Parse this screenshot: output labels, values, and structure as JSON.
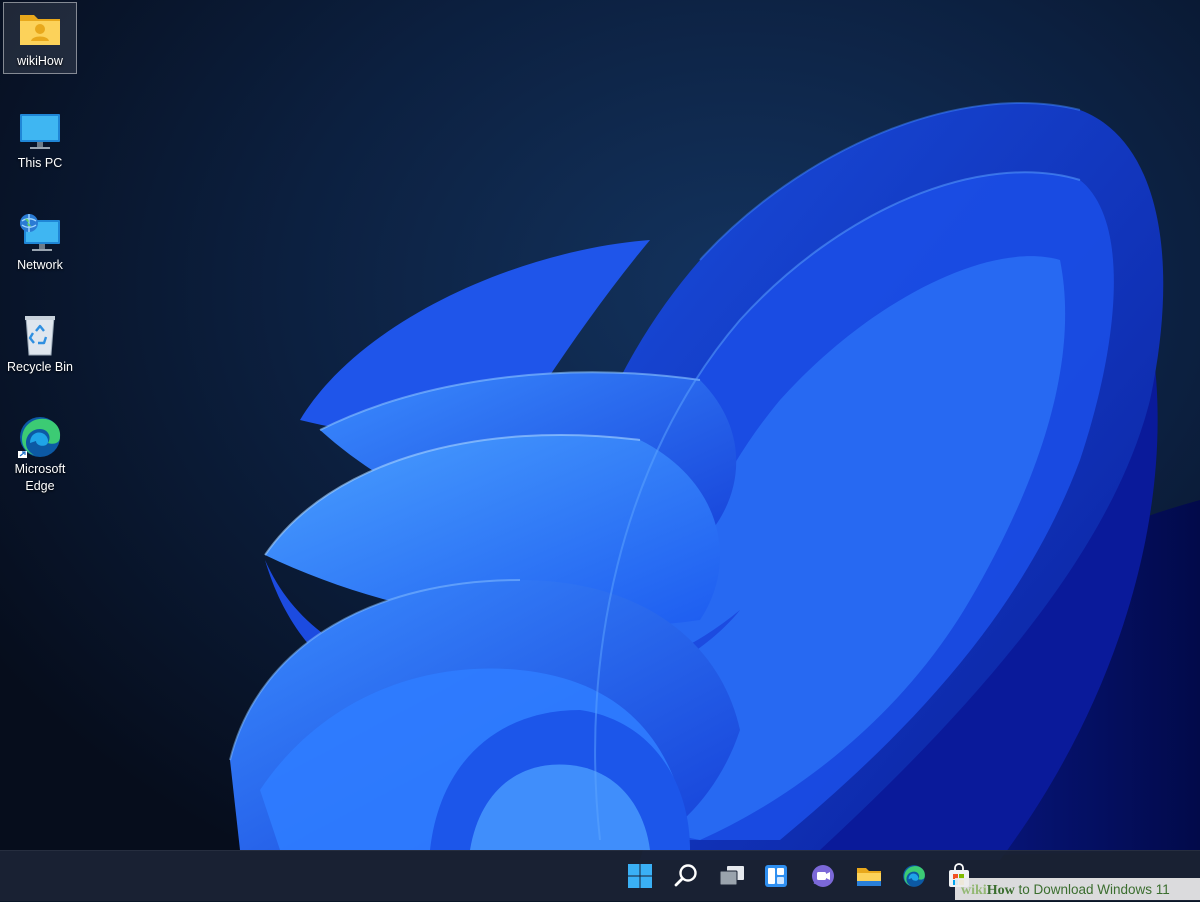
{
  "desktop": {
    "icons": [
      {
        "label": "wikiHow",
        "icon": "user-folder-icon",
        "selected": true
      },
      {
        "label": "This PC",
        "icon": "monitor-icon"
      },
      {
        "label": "Network",
        "icon": "network-icon"
      },
      {
        "label": "Recycle Bin",
        "icon": "recycle-bin-icon"
      },
      {
        "label": "Microsoft Edge",
        "icon": "edge-icon"
      }
    ]
  },
  "taskbar": {
    "buttons": [
      {
        "name": "start",
        "icon": "windows-logo-icon"
      },
      {
        "name": "search",
        "icon": "search-icon"
      },
      {
        "name": "task-view",
        "icon": "task-view-icon"
      },
      {
        "name": "widgets",
        "icon": "widgets-icon"
      },
      {
        "name": "teams-chat",
        "icon": "chat-icon"
      },
      {
        "name": "file-explorer",
        "icon": "folder-icon"
      },
      {
        "name": "edge",
        "icon": "edge-icon"
      },
      {
        "name": "store",
        "icon": "store-icon"
      }
    ]
  },
  "watermark": {
    "wiki": "wiki",
    "how": "How",
    "text": " to Download Windows 11"
  },
  "colors": {
    "accent": "#1e6cf0",
    "background": "#0a1628",
    "taskbar": "#1a2234"
  }
}
